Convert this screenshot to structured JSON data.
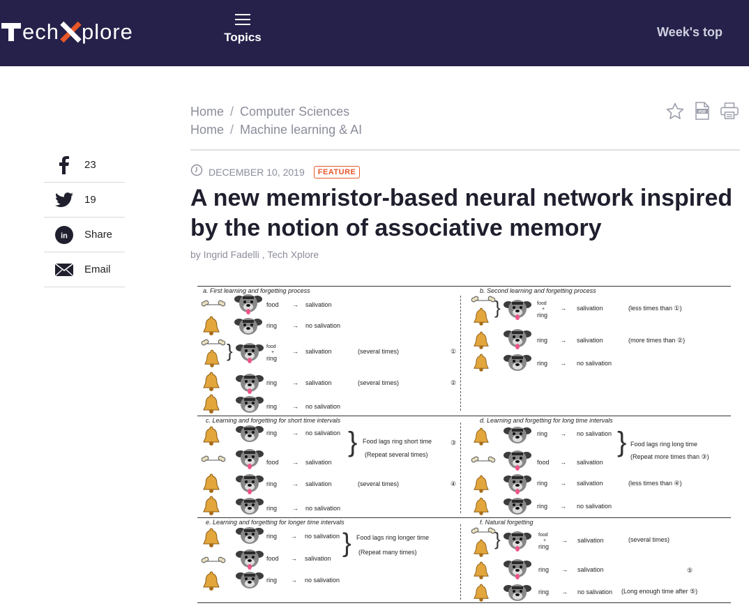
{
  "header": {
    "logo_text_1": "ech",
    "logo_text_2": "plore",
    "topics_label": "Topics",
    "weeks_top_label": "Week's top",
    "colors": {
      "bar": "#25214a",
      "accent": "#e8562a"
    }
  },
  "social": {
    "items": [
      {
        "icon": "facebook-icon",
        "label": "23"
      },
      {
        "icon": "twitter-icon",
        "label": "19"
      },
      {
        "icon": "linkedin-icon",
        "label": "Share"
      },
      {
        "icon": "email-icon",
        "label": "Email"
      }
    ]
  },
  "breadcrumbs": [
    {
      "home": "Home",
      "sep": "/",
      "section": "Computer Sciences"
    },
    {
      "home": "Home",
      "sep": "/",
      "section": "Machine learning & AI"
    }
  ],
  "tools": [
    "star-icon",
    "pdf-icon",
    "print-icon"
  ],
  "article": {
    "date": "DECEMBER 10, 2019",
    "badge": "FEATURE",
    "title": "A new memristor-based neural network inspired by the notion of associative memory",
    "byline": "by Ingrid Fadelli , Tech Xplore"
  },
  "figure": {
    "panel_a": "a. First learning and forgetting process",
    "panel_b": "b. Second learning and forgetting process",
    "panel_c": "c. Learning and forgetting for short time intervals",
    "panel_d": "d. Learning and forgetting for long time intervals",
    "panel_e": "e. Learning and forgetting for longer time intervals",
    "panel_f": "f. Natural forgetting",
    "food": "food",
    "ring": "ring",
    "plus": "+",
    "arrow": "→",
    "salivation": "salivation",
    "no_salivation": "no salivation",
    "several_times": "(several times)",
    "less_than_1": "(less times than ①)",
    "more_than_2": "(more times than ②)",
    "less_than_4": "(less times than ④)",
    "n1": "①",
    "n2": "②",
    "n3": "③",
    "n4": "④",
    "n5": "⑤",
    "short_1": "Food lags ring short time",
    "short_2": "(Repeat several times)",
    "long_1": "Food lags ring long time",
    "long_2": "(Repeat more times than ③)",
    "longer_1": "Food lags ring longer time",
    "longer_2": "(Repeat many times)",
    "long_enough": "(Long enough time after ⑤)"
  }
}
